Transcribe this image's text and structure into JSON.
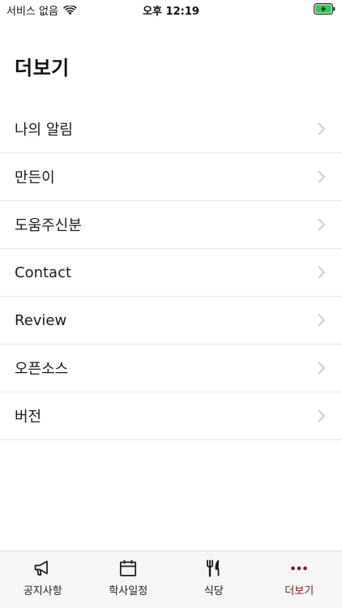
{
  "status_bar": {
    "carrier": "서비스 없음",
    "time": "오후 12:19"
  },
  "page": {
    "title": "더보기"
  },
  "menu": {
    "items": [
      {
        "label": "나의 알림"
      },
      {
        "label": "만든이"
      },
      {
        "label": "도움주신분"
      },
      {
        "label": "Contact"
      },
      {
        "label": "Review"
      },
      {
        "label": "오픈소스"
      },
      {
        "label": "버전"
      }
    ]
  },
  "tab_bar": {
    "tabs": [
      {
        "label": "공지사항",
        "icon": "megaphone-icon"
      },
      {
        "label": "학사일정",
        "icon": "calendar-icon"
      },
      {
        "label": "식당",
        "icon": "fork-knife-icon"
      },
      {
        "label": "더보기",
        "icon": "more-dots-icon",
        "active": true
      }
    ]
  },
  "colors": {
    "accent": "#7a1a1a",
    "battery": "#34c759",
    "chevron": "#c4c4c4"
  }
}
